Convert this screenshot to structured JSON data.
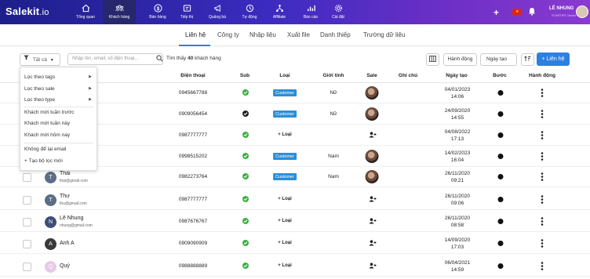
{
  "app": {
    "logo_main": "Salekit",
    "logo_suffix": ".io"
  },
  "nav": [
    {
      "label": "Tổng quan",
      "icon": "home-icon"
    },
    {
      "label": "Khách hàng",
      "icon": "users-icon",
      "active": true
    },
    {
      "label": "Bán hàng",
      "icon": "dollar-icon"
    },
    {
      "label": "Tiếp thị",
      "icon": "ticket-icon"
    },
    {
      "label": "Quảng bá",
      "icon": "megaphone-icon"
    },
    {
      "label": "Tự động",
      "icon": "automation-icon"
    },
    {
      "label": "Affiliate",
      "icon": "network-icon"
    },
    {
      "label": "Báo cáo",
      "icon": "chart-icon"
    },
    {
      "label": "Cài đặt",
      "icon": "gear-icon"
    }
  ],
  "user": {
    "name": "LÊ NHUNG",
    "role": "STARTER",
    "shop": "Owner"
  },
  "colors": {
    "accent": "#2d7fe0",
    "badge": "#2d8ed6",
    "check": "#3cb043"
  },
  "subtabs": [
    "Liên hệ",
    "Công ty",
    "Nhập liệu",
    "Xuất file",
    "Danh thiếp",
    "Trường dữ liệu"
  ],
  "toolbar": {
    "filter_label": "Tất cả",
    "search_placeholder": "Nhập tên, email, số điện thoại...",
    "found_prefix": "Tìm thấy",
    "found_count": "40",
    "found_suffix": "khách hàng",
    "action_label": "Hành động",
    "date_label": "Ngày tạo",
    "add_label": "+ Liên hệ"
  },
  "columns": [
    "Điện thoại",
    "Sub",
    "Loại",
    "Giới tính",
    "Sale",
    "Ghi chú",
    "Ngày tạo",
    "Bước",
    "Hành động"
  ],
  "filter_menu": {
    "items": [
      "Lọc theo tags",
      "Lọc theo sale",
      "Lọc theo type",
      "Khách mới tuần trước",
      "Khách mới tuần này",
      "Khách mới hôm nay",
      "Không để lại email",
      "+ Tạo bộ lọc mới"
    ]
  },
  "add_type_label": "+ Loại",
  "rows": [
    {
      "name": "",
      "email": "",
      "phone": "0945667788",
      "sub": "check",
      "type": "Customer",
      "gender": "Nữ",
      "sale": "avatar",
      "date": "04/01/2023",
      "time": "14:06"
    },
    {
      "name": "",
      "email": "",
      "phone": "0909056454",
      "sub": "check-dark",
      "type": "Customer",
      "gender": "Nữ",
      "sale": "avatar",
      "date": "24/09/2020",
      "time": "14:55"
    },
    {
      "name": "",
      "email": "",
      "phone": "0987777777",
      "sub": "check",
      "type": "add",
      "gender": "",
      "sale": "add",
      "date": "04/08/2022",
      "time": "17:13"
    },
    {
      "name": "",
      "email": "",
      "phone": "0998515202",
      "sub": "check",
      "type": "Customer",
      "gender": "Nam",
      "sale": "avatar",
      "date": "14/02/2023",
      "time": "16:04"
    },
    {
      "name": "Thái",
      "email": "thai@gmail.com",
      "avatar": "T",
      "avatar_color": "#5b6e86",
      "phone": "0982273764",
      "sub": "check",
      "type": "Customer",
      "gender": "Nam",
      "sale": "avatar",
      "date": "26/11/2020",
      "time": "09:21"
    },
    {
      "name": "Thư",
      "email": "thu@gmail.com",
      "avatar": "T",
      "avatar_color": "#5b6e86",
      "phone": "0987777777",
      "sub": "check",
      "type": "add",
      "gender": "",
      "sale": "add",
      "date": "26/11/2020",
      "time": "09:06"
    },
    {
      "name": "Lê Nhung",
      "email": "nhung@gmail.com",
      "avatar": "N",
      "avatar_color": "#3f4d78",
      "phone": "0987676767",
      "sub": "check",
      "type": "add",
      "gender": "",
      "sale": "add",
      "date": "26/11/2020",
      "time": "08:58"
    },
    {
      "name": "Anh A",
      "email": "",
      "avatar": "A",
      "avatar_color": "#3a3a3a",
      "phone": "0909090909",
      "sub": "check",
      "type": "add",
      "gender": "",
      "sale": "add",
      "date": "14/09/2020",
      "time": "17:03"
    },
    {
      "name": "Quý",
      "email": "",
      "avatar": "Q",
      "avatar_color": "#e8c9e6",
      "phone": "0988888889",
      "sub": "check",
      "type": "add",
      "gender": "",
      "sale": "add",
      "date": "06/04/2021",
      "time": "14:59"
    }
  ]
}
